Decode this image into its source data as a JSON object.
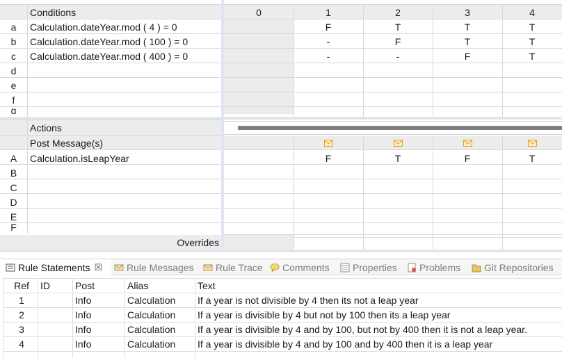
{
  "decision_table": {
    "conditions_header": "Conditions",
    "actions_header": "Actions",
    "post_message_label": "Post Message(s)",
    "overrides_label": "Overrides",
    "rule_columns": [
      "0",
      "1",
      "2",
      "3",
      "4"
    ],
    "conditions": [
      {
        "id": "a",
        "expr": "Calculation.dateYear.mod ( 4 ) = 0",
        "values": [
          "",
          "F",
          "T",
          "T",
          "T"
        ]
      },
      {
        "id": "b",
        "expr": "Calculation.dateYear.mod ( 100 ) = 0",
        "values": [
          "",
          "-",
          "F",
          "T",
          "T"
        ]
      },
      {
        "id": "c",
        "expr": "Calculation.dateYear.mod ( 400 ) = 0",
        "values": [
          "",
          "-",
          "-",
          "F",
          "T"
        ]
      },
      {
        "id": "d",
        "expr": "",
        "values": [
          "",
          "",
          "",
          "",
          ""
        ]
      },
      {
        "id": "e",
        "expr": "",
        "values": [
          "",
          "",
          "",
          "",
          ""
        ]
      },
      {
        "id": "f",
        "expr": "",
        "values": [
          "",
          "",
          "",
          "",
          ""
        ]
      },
      {
        "id": "g",
        "expr": "",
        "values": [
          "",
          "",
          "",
          "",
          ""
        ]
      }
    ],
    "actions": [
      {
        "id": "A",
        "expr": "Calculation.isLeapYear",
        "values": [
          "",
          "F",
          "T",
          "F",
          "T"
        ]
      },
      {
        "id": "B",
        "expr": "",
        "values": [
          "",
          "",
          "",
          "",
          ""
        ]
      },
      {
        "id": "C",
        "expr": "",
        "values": [
          "",
          "",
          "",
          "",
          ""
        ]
      },
      {
        "id": "D",
        "expr": "",
        "values": [
          "",
          "",
          "",
          "",
          ""
        ]
      },
      {
        "id": "E",
        "expr": "",
        "values": [
          "",
          "",
          "",
          "",
          ""
        ]
      },
      {
        "id": "F",
        "expr": "",
        "values": [
          "",
          "",
          "",
          "",
          ""
        ]
      }
    ]
  },
  "tabs": [
    {
      "label": "Rule Statements",
      "icon": "rule-statements-icon",
      "active": true,
      "close": "☒"
    },
    {
      "label": "Rule Messages",
      "icon": "envelope-icon",
      "active": false
    },
    {
      "label": "Rule Trace",
      "icon": "envelope-icon",
      "active": false
    },
    {
      "label": "Comments",
      "icon": "comment-bubble-icon",
      "active": false
    },
    {
      "label": "Properties",
      "icon": "properties-icon",
      "active": false
    },
    {
      "label": "Problems",
      "icon": "problems-icon",
      "active": false
    },
    {
      "label": "Git Repositories",
      "icon": "git-repositories-icon",
      "active": false
    }
  ],
  "rule_statements": {
    "columns": [
      "Ref",
      "ID",
      "Post",
      "Alias",
      "Text"
    ],
    "rows": [
      {
        "ref": "1",
        "id": "",
        "post": "Info",
        "alias": "Calculation",
        "text": "If a year is not divisible by 4 then its not a leap year"
      },
      {
        "ref": "2",
        "id": "",
        "post": "Info",
        "alias": "Calculation",
        "text": "If a year is divisible by 4 but not by 100 then its a leap year"
      },
      {
        "ref": "3",
        "id": "",
        "post": "Info",
        "alias": "Calculation",
        "text": "If a year is divisible by 4 and by 100, but not by 400 then it is not a leap year."
      },
      {
        "ref": "4",
        "id": "",
        "post": "Info",
        "alias": "Calculation",
        "text": "If a year is divisible by 4 and by 100 and by 400 then it is a leap year"
      }
    ]
  },
  "colors": {
    "header_bg": "#ececec",
    "grid_line": "#d8d8d8",
    "splitter": "#7f7f7f",
    "envelope": "#e0a21f",
    "tab_inactive": "#7b7b7b"
  }
}
